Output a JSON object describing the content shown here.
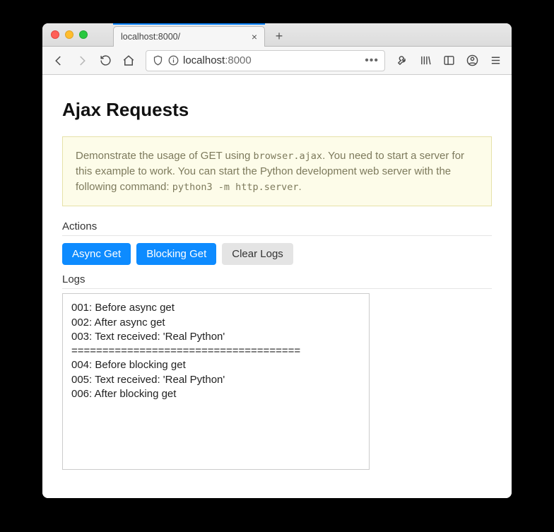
{
  "browser": {
    "tab_title": "localhost:8000/",
    "url_host": "localhost",
    "url_port": ":8000"
  },
  "page": {
    "heading": "Ajax Requests",
    "alert_part1": "Demonstrate the usage of GET using ",
    "alert_code1": "browser.ajax",
    "alert_part2": ". You need to start a server for this example to work. You can start the Python development web server with the following command: ",
    "alert_code2": "python3 -m http.server",
    "alert_part3": ".",
    "actions_label": "Actions",
    "logs_label": "Logs",
    "buttons": {
      "async_get": "Async Get",
      "blocking_get": "Blocking Get",
      "clear_logs": "Clear Logs"
    },
    "logs": "001: Before async get\n002: After async get\n003: Text received: 'Real Python'\n=====================================\n004: Before blocking get\n005: Text received: 'Real Python'\n006: After blocking get"
  }
}
